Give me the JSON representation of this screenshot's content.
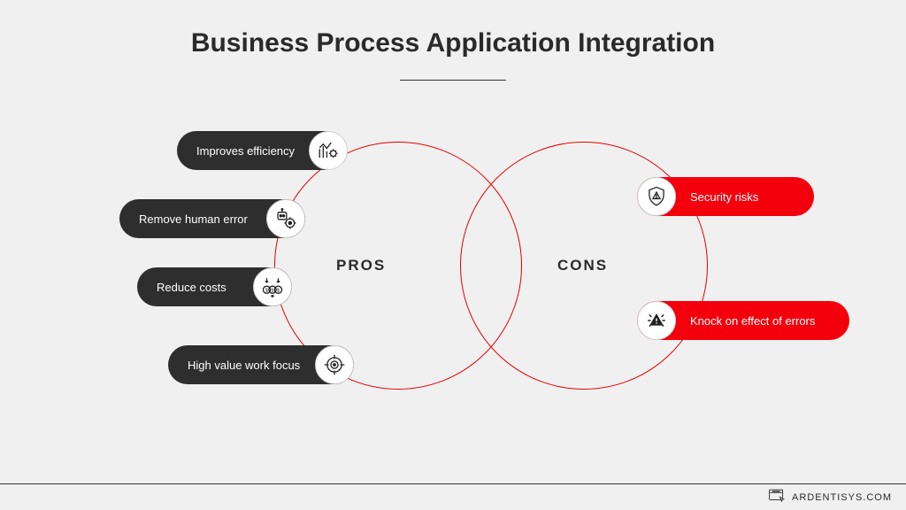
{
  "title": "Business Process Application Integration",
  "labels": {
    "pros": "PROS",
    "cons": "CONS"
  },
  "pros": [
    {
      "text": "Improves efficiency",
      "icon": "chart-gear-icon"
    },
    {
      "text": "Remove human error",
      "icon": "robot-target-icon"
    },
    {
      "text": "Reduce costs",
      "icon": "dollars-down-icon"
    },
    {
      "text": "High value work focus",
      "icon": "crosshair-icon"
    }
  ],
  "cons": [
    {
      "text": "Security risks",
      "icon": "shield-alert-icon"
    },
    {
      "text": "Knock on effect of errors",
      "icon": "warning-rays-icon"
    }
  ],
  "footer": "ARDENTISYS.COM",
  "colors": {
    "dark": "#2e2e2e",
    "red": "#f4000d",
    "accent": "#e60000"
  }
}
